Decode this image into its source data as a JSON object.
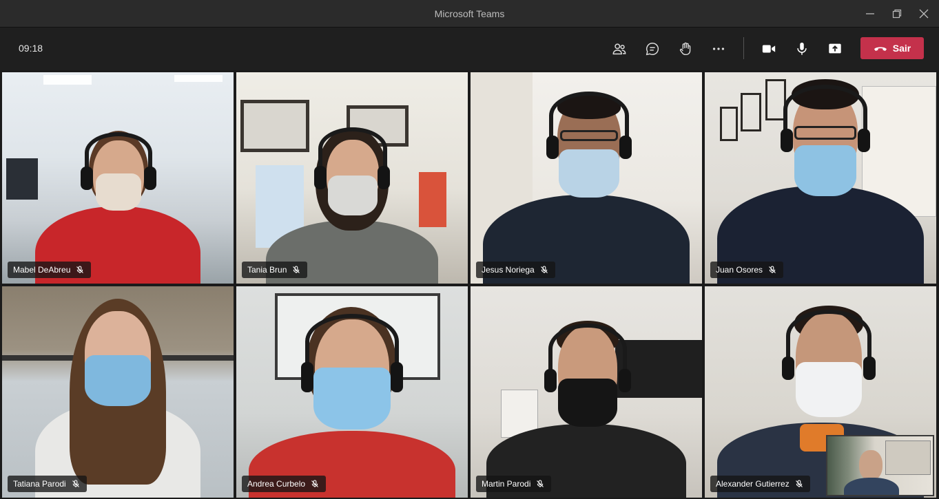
{
  "window": {
    "title": "Microsoft Teams"
  },
  "controls": {
    "time": "09:18",
    "leave_label": "Sair",
    "icons": [
      "people-icon",
      "chat-icon",
      "raise-hand-icon",
      "more-icon",
      "camera-icon",
      "mic-icon",
      "share-screen-icon",
      "hang-up-icon"
    ]
  },
  "colors": {
    "leave": "#c4314b",
    "titlebar": "#2b2b2b",
    "controls": "#1f1f1f"
  },
  "participants": [
    {
      "name": "Mabel DeAbreu",
      "muted": true
    },
    {
      "name": "Tania Brun",
      "muted": true
    },
    {
      "name": "Jesus Noriega",
      "muted": true
    },
    {
      "name": "Juan Osores",
      "muted": true
    },
    {
      "name": "Tatiana Parodi",
      "muted": true
    },
    {
      "name": "Andrea Curbelo",
      "muted": true
    },
    {
      "name": "Martin Parodi",
      "muted": true
    },
    {
      "name": "Alexander Gutierrez",
      "muted": true
    }
  ]
}
